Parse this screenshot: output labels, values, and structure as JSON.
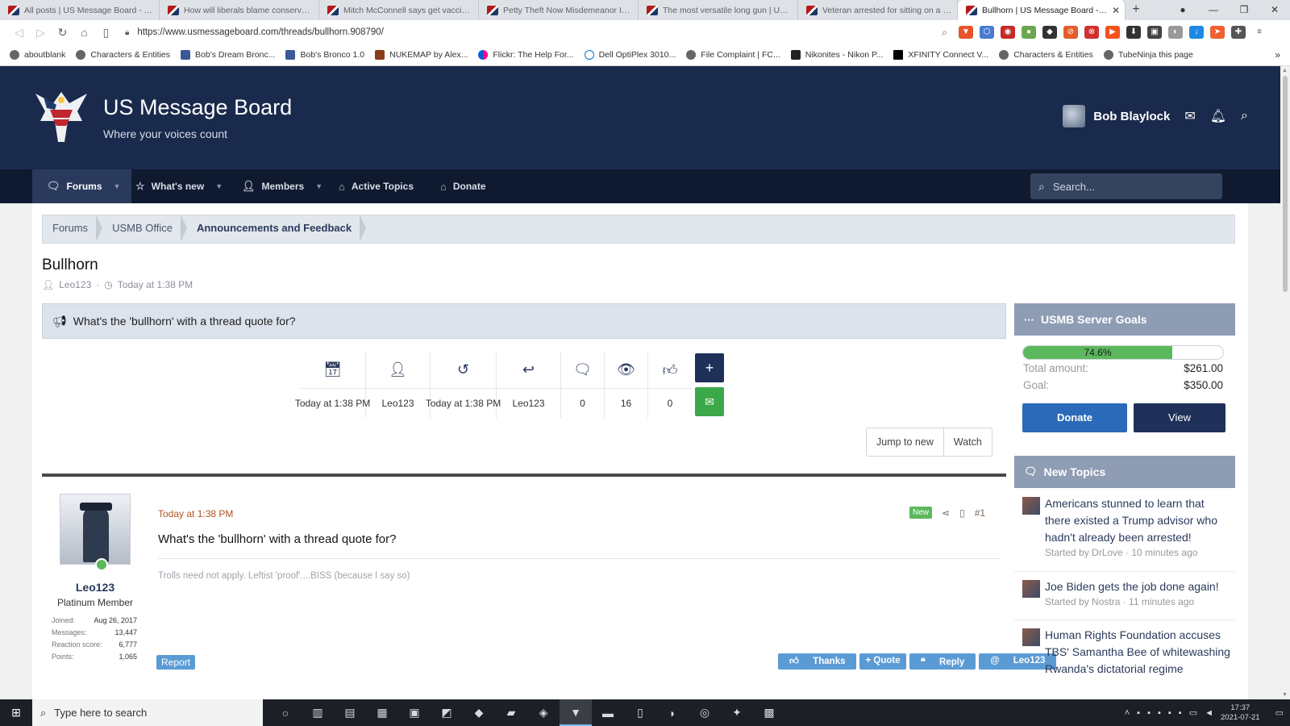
{
  "browser": {
    "tabs": [
      {
        "title": "All posts | US Message Board - Politic",
        "active": false
      },
      {
        "title": "How will liberals blame conservatives",
        "active": false
      },
      {
        "title": "Mitch McConnell says get vaccinated",
        "active": false
      },
      {
        "title": "Petty Theft Now Misdemeanor In CA",
        "active": false
      },
      {
        "title": "The most versatile long gun | US Mes",
        "active": false
      },
      {
        "title": "Veteran arrested for sitting on a benc",
        "active": false
      },
      {
        "title": "Bullhorn | US Message Board - Pc",
        "active": true
      }
    ],
    "url": "https://www.usmessageboard.com/threads/bullhorn.908790/",
    "bookmarks": [
      "aboutblank",
      "Characters & Entities",
      "Bob's Dream Bronc...",
      "Bob's Bronco 1.0",
      "NUKEMAP by Alex...",
      "Flickr: The Help For...",
      "Dell OptiPlex 3010...",
      "File Complaint | FC...",
      "Nikonites - Nikon P...",
      "XFINITY Connect V...",
      "Characters & Entities",
      "TubeNinja this page"
    ]
  },
  "site": {
    "title": "US Message Board",
    "tagline": "Where your voices count",
    "username": "Bob Blaylock"
  },
  "nav": {
    "forums": "Forums",
    "whats_new": "What's new",
    "members": "Members",
    "active_topics": "Active Topics",
    "donate": "Donate",
    "search_placeholder": "Search..."
  },
  "breadcrumb": [
    "Forums",
    "USMB Office",
    "Announcements and Feedback"
  ],
  "thread": {
    "title": "Bullhorn",
    "author": "Leo123",
    "time": "Today at 1:38 PM",
    "notice": "What's the 'bullhorn' with a thread quote for?",
    "stats": {
      "created": "Today at 1:38 PM",
      "starter": "Leo123",
      "last_post": "Today at 1:38 PM",
      "last_poster": "Leo123",
      "replies": "0",
      "views": "16",
      "likes": "0"
    },
    "jump_to_new": "Jump to new",
    "watch": "Watch"
  },
  "post": {
    "username": "Leo123",
    "role": "Platinum Member",
    "user_stats": [
      {
        "label": "Joined:",
        "value": "Aug 26, 2017"
      },
      {
        "label": "Messages:",
        "value": "13,447"
      },
      {
        "label": "Reaction score:",
        "value": "6,777"
      },
      {
        "label": "Points:",
        "value": "1,065"
      }
    ],
    "date": "Today at 1:38 PM",
    "new_badge": "New",
    "number": "#1",
    "body": "What's the 'bullhorn' with a thread quote for?",
    "signature": "Trolls need not apply. Leftist 'proof'....BISS (because I say so)",
    "report": "Report",
    "actions": {
      "thanks": "Thanks",
      "quote": "+ Quote",
      "reply": "Reply",
      "mention": "Leo123"
    }
  },
  "sidebar": {
    "goals": {
      "title": "USMB Server Goals",
      "percent_label": "74.6%",
      "percent": 74.6,
      "total_label": "Total amount:",
      "total_value": "$261.00",
      "goal_label": "Goal:",
      "goal_value": "$350.00",
      "donate": "Donate",
      "view": "View"
    },
    "new_topics": {
      "title": "New Topics",
      "items": [
        {
          "title": "Americans stunned to learn that there existed a Trump advisor who hadn't already been arrested!",
          "meta": "Started by DrLove · 10 minutes ago"
        },
        {
          "title": "Joe Biden gets the job done again!",
          "meta": "Started by Nostra · 11 minutes ago"
        },
        {
          "title": "Human Rights Foundation accuses TBS' Samantha Bee of whitewashing Rwanda's dictatorial regime",
          "meta": ""
        }
      ]
    }
  },
  "taskbar": {
    "search_placeholder": "Type here to search",
    "time": "17:37",
    "date": "2021-07-21"
  },
  "colors": {
    "header_bg": "#1a2a4d",
    "nav_bg": "#0f1a30",
    "accent_green": "#5cb85c",
    "button_blue": "#5b9bd5",
    "donate_blue": "#2a6ab8"
  }
}
